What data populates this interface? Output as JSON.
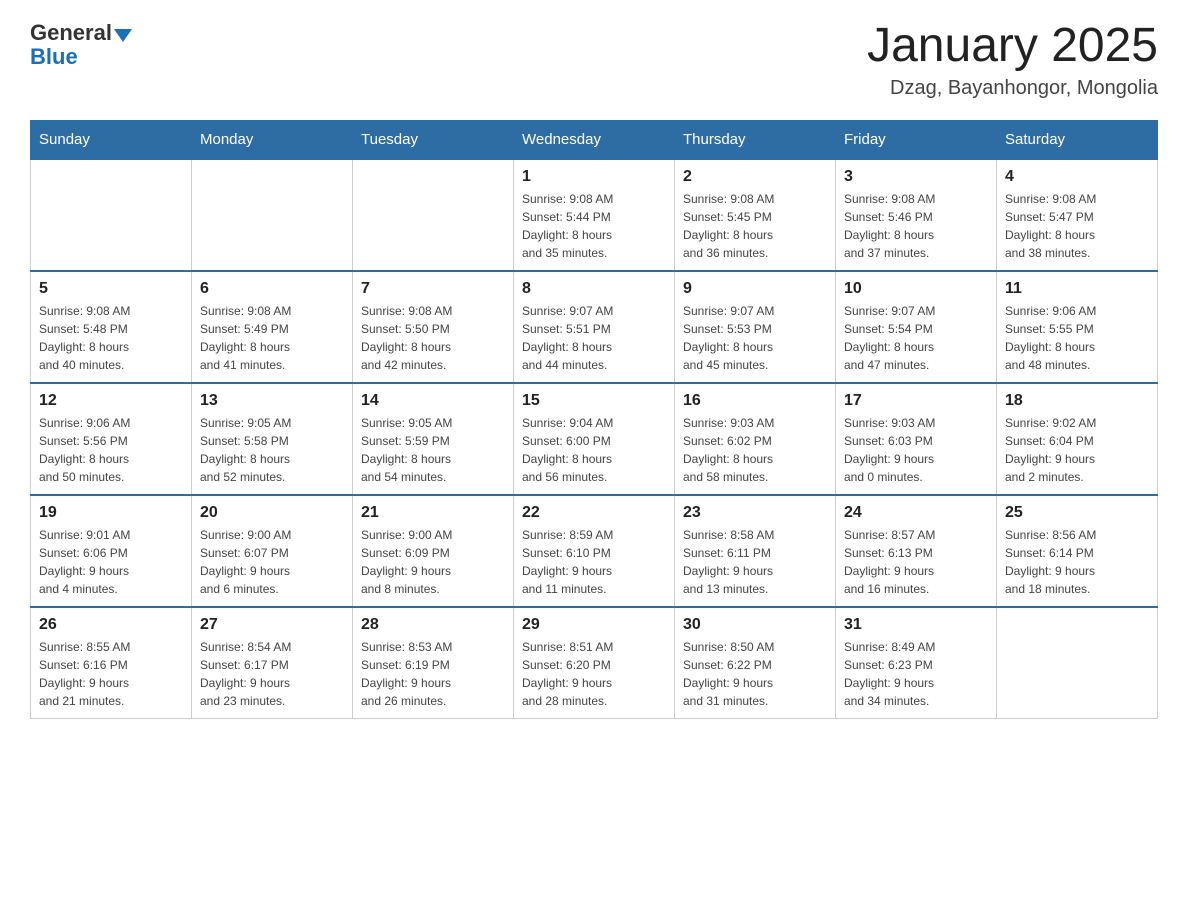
{
  "logo": {
    "general": "General",
    "blue": "Blue"
  },
  "title": "January 2025",
  "subtitle": "Dzag, Bayanhongor, Mongolia",
  "weekdays": [
    "Sunday",
    "Monday",
    "Tuesday",
    "Wednesday",
    "Thursday",
    "Friday",
    "Saturday"
  ],
  "weeks": [
    [
      {
        "day": "",
        "info": ""
      },
      {
        "day": "",
        "info": ""
      },
      {
        "day": "",
        "info": ""
      },
      {
        "day": "1",
        "info": "Sunrise: 9:08 AM\nSunset: 5:44 PM\nDaylight: 8 hours\nand 35 minutes."
      },
      {
        "day": "2",
        "info": "Sunrise: 9:08 AM\nSunset: 5:45 PM\nDaylight: 8 hours\nand 36 minutes."
      },
      {
        "day": "3",
        "info": "Sunrise: 9:08 AM\nSunset: 5:46 PM\nDaylight: 8 hours\nand 37 minutes."
      },
      {
        "day": "4",
        "info": "Sunrise: 9:08 AM\nSunset: 5:47 PM\nDaylight: 8 hours\nand 38 minutes."
      }
    ],
    [
      {
        "day": "5",
        "info": "Sunrise: 9:08 AM\nSunset: 5:48 PM\nDaylight: 8 hours\nand 40 minutes."
      },
      {
        "day": "6",
        "info": "Sunrise: 9:08 AM\nSunset: 5:49 PM\nDaylight: 8 hours\nand 41 minutes."
      },
      {
        "day": "7",
        "info": "Sunrise: 9:08 AM\nSunset: 5:50 PM\nDaylight: 8 hours\nand 42 minutes."
      },
      {
        "day": "8",
        "info": "Sunrise: 9:07 AM\nSunset: 5:51 PM\nDaylight: 8 hours\nand 44 minutes."
      },
      {
        "day": "9",
        "info": "Sunrise: 9:07 AM\nSunset: 5:53 PM\nDaylight: 8 hours\nand 45 minutes."
      },
      {
        "day": "10",
        "info": "Sunrise: 9:07 AM\nSunset: 5:54 PM\nDaylight: 8 hours\nand 47 minutes."
      },
      {
        "day": "11",
        "info": "Sunrise: 9:06 AM\nSunset: 5:55 PM\nDaylight: 8 hours\nand 48 minutes."
      }
    ],
    [
      {
        "day": "12",
        "info": "Sunrise: 9:06 AM\nSunset: 5:56 PM\nDaylight: 8 hours\nand 50 minutes."
      },
      {
        "day": "13",
        "info": "Sunrise: 9:05 AM\nSunset: 5:58 PM\nDaylight: 8 hours\nand 52 minutes."
      },
      {
        "day": "14",
        "info": "Sunrise: 9:05 AM\nSunset: 5:59 PM\nDaylight: 8 hours\nand 54 minutes."
      },
      {
        "day": "15",
        "info": "Sunrise: 9:04 AM\nSunset: 6:00 PM\nDaylight: 8 hours\nand 56 minutes."
      },
      {
        "day": "16",
        "info": "Sunrise: 9:03 AM\nSunset: 6:02 PM\nDaylight: 8 hours\nand 58 minutes."
      },
      {
        "day": "17",
        "info": "Sunrise: 9:03 AM\nSunset: 6:03 PM\nDaylight: 9 hours\nand 0 minutes."
      },
      {
        "day": "18",
        "info": "Sunrise: 9:02 AM\nSunset: 6:04 PM\nDaylight: 9 hours\nand 2 minutes."
      }
    ],
    [
      {
        "day": "19",
        "info": "Sunrise: 9:01 AM\nSunset: 6:06 PM\nDaylight: 9 hours\nand 4 minutes."
      },
      {
        "day": "20",
        "info": "Sunrise: 9:00 AM\nSunset: 6:07 PM\nDaylight: 9 hours\nand 6 minutes."
      },
      {
        "day": "21",
        "info": "Sunrise: 9:00 AM\nSunset: 6:09 PM\nDaylight: 9 hours\nand 8 minutes."
      },
      {
        "day": "22",
        "info": "Sunrise: 8:59 AM\nSunset: 6:10 PM\nDaylight: 9 hours\nand 11 minutes."
      },
      {
        "day": "23",
        "info": "Sunrise: 8:58 AM\nSunset: 6:11 PM\nDaylight: 9 hours\nand 13 minutes."
      },
      {
        "day": "24",
        "info": "Sunrise: 8:57 AM\nSunset: 6:13 PM\nDaylight: 9 hours\nand 16 minutes."
      },
      {
        "day": "25",
        "info": "Sunrise: 8:56 AM\nSunset: 6:14 PM\nDaylight: 9 hours\nand 18 minutes."
      }
    ],
    [
      {
        "day": "26",
        "info": "Sunrise: 8:55 AM\nSunset: 6:16 PM\nDaylight: 9 hours\nand 21 minutes."
      },
      {
        "day": "27",
        "info": "Sunrise: 8:54 AM\nSunset: 6:17 PM\nDaylight: 9 hours\nand 23 minutes."
      },
      {
        "day": "28",
        "info": "Sunrise: 8:53 AM\nSunset: 6:19 PM\nDaylight: 9 hours\nand 26 minutes."
      },
      {
        "day": "29",
        "info": "Sunrise: 8:51 AM\nSunset: 6:20 PM\nDaylight: 9 hours\nand 28 minutes."
      },
      {
        "day": "30",
        "info": "Sunrise: 8:50 AM\nSunset: 6:22 PM\nDaylight: 9 hours\nand 31 minutes."
      },
      {
        "day": "31",
        "info": "Sunrise: 8:49 AM\nSunset: 6:23 PM\nDaylight: 9 hours\nand 34 minutes."
      },
      {
        "day": "",
        "info": ""
      }
    ]
  ]
}
